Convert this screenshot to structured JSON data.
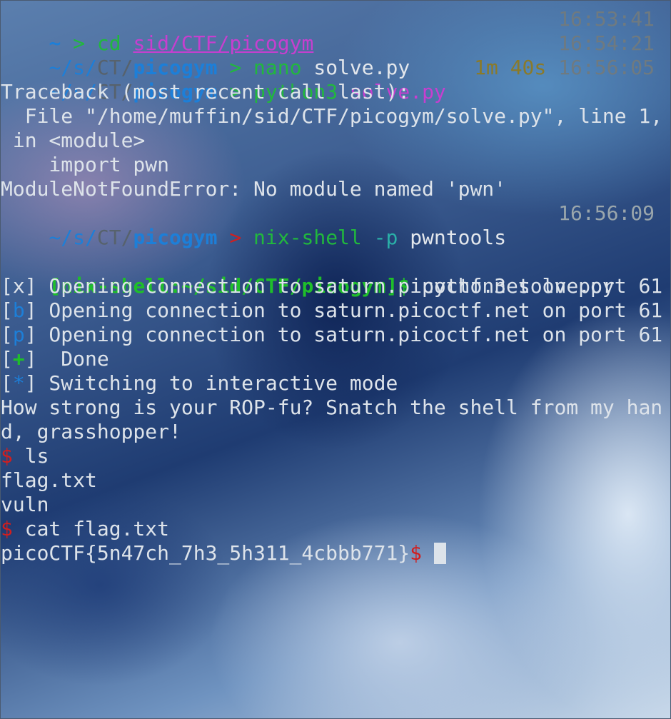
{
  "prompt": {
    "tilde": "~",
    "arrow": ">",
    "path_head": "~/s/",
    "path_mid": "CT/",
    "path_tail": "picogym"
  },
  "cmd1": {
    "cmd": "cd",
    "arg": "sid/CTF/picogym",
    "time": "16:53:41"
  },
  "cmd2": {
    "cmd": "nano",
    "arg": "solve.py",
    "time": "16:54:21"
  },
  "cmd3": {
    "cmd": "python3",
    "arg": "solve.py",
    "duration": "1m 40s",
    "time": "16:56:05"
  },
  "traceback": [
    "Traceback (most recent call last):",
    "  File \"/home/muffin/sid/CTF/picogym/solve.py\", line 1,",
    " in <module>",
    "    import pwn",
    "ModuleNotFoundError: No module named 'pwn'"
  ],
  "cmd4": {
    "cmd": "nix-shell",
    "flag": "-p",
    "arg": "pwntools",
    "time": "16:56:09"
  },
  "nix_prompt": "[nix-shell:~/sid/CTF/picogym]$",
  "nix_cmd": "python3 solve.py",
  "pwn_lines": [
    {
      "open": "[",
      "mark": "x",
      "close": "]",
      "text": " Opening connection to saturn.picoctf.net on port 61"
    },
    {
      "open": "[",
      "mark": "b",
      "close": "]",
      "text": " Opening connection to saturn.picoctf.net on port 61"
    },
    {
      "open": "[",
      "mark": "p",
      "close": "]",
      "text": " Opening connection to saturn.picoctf.net on port 61"
    },
    {
      "open": "[",
      "mark": "+",
      "close": "]",
      "text": "  Done"
    },
    {
      "open": "[",
      "mark": "*",
      "close": "]",
      "text": " Switching to interactive mode"
    }
  ],
  "banner": [
    "How strong is your ROP-fu? Snatch the shell from my han",
    "d, grasshopper!"
  ],
  "shell_prompt": "$",
  "shell_cmd1": "ls",
  "ls_output": [
    "flag.txt",
    "vuln"
  ],
  "shell_cmd2": "cat flag.txt",
  "flag": "picoCTF{5n47ch_7h3_5h311_4cbbb771}",
  "colors": {
    "blue": "#1d7fd8",
    "green": "#21b83d",
    "magenta": "#c63fcf",
    "red": "#d21e1e"
  }
}
